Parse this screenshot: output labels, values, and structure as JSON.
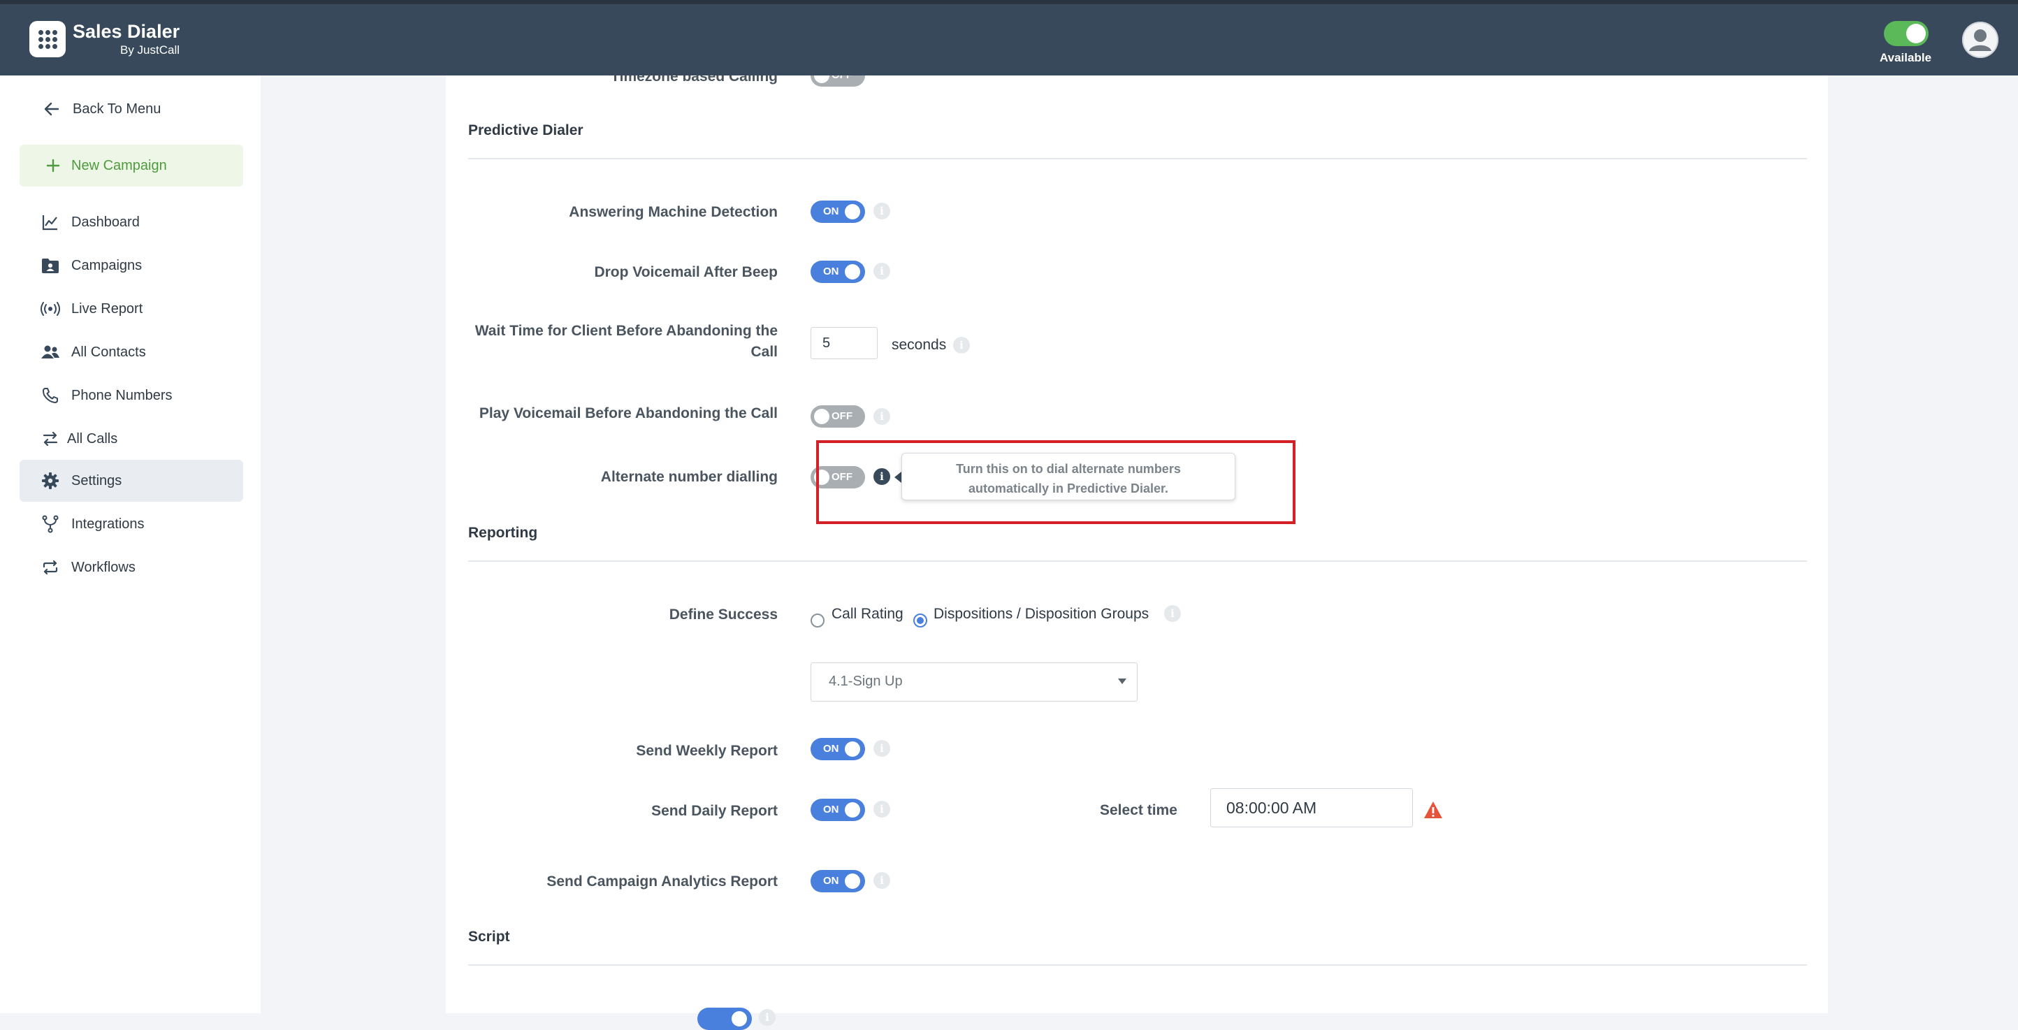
{
  "header": {
    "app_title": "Sales Dialer",
    "app_subtitle": "By JustCall",
    "status_label": "Available"
  },
  "colors": {
    "header_bg": "#37495a",
    "toggle_on": "#4a80dd",
    "toggle_off": "#a9aeb3",
    "available_green": "#5bb95a",
    "highlight_red": "#d42027",
    "new_campaign_green": "#4e9b3d"
  },
  "sidebar": {
    "items": [
      {
        "label": "Back To Menu",
        "icon": "arrow-left-icon"
      },
      {
        "label": "New Campaign",
        "icon": "plus-icon"
      },
      {
        "label": "Dashboard",
        "icon": "chart-line-icon"
      },
      {
        "label": "Campaigns",
        "icon": "folder-user-icon"
      },
      {
        "label": "Live Report",
        "icon": "broadcast-icon"
      },
      {
        "label": "All Contacts",
        "icon": "users-icon"
      },
      {
        "label": "Phone Numbers",
        "icon": "phone-icon"
      },
      {
        "label": "All Calls",
        "icon": "arrows-swap-icon"
      },
      {
        "label": "Settings",
        "icon": "gear-icon",
        "active": true
      },
      {
        "label": "Integrations",
        "icon": "integration-fork-icon"
      },
      {
        "label": "Workflows",
        "icon": "repeat-icon"
      }
    ]
  },
  "main": {
    "partial_top": {
      "label": "Timezone based Calling",
      "state": "OFF"
    },
    "predictive": {
      "title": "Predictive Dialer",
      "amd": {
        "label": "Answering Machine Detection",
        "state": "ON"
      },
      "drop_vm": {
        "label": "Drop Voicemail After Beep",
        "state": "ON"
      },
      "wait_time": {
        "label_line1": "Wait Time for Client Before Abandoning the",
        "label_line2": "Call",
        "value": "5",
        "unit": "seconds"
      },
      "play_vm": {
        "label": "Play Voicemail Before Abandoning the Call",
        "state": "OFF"
      },
      "alternate": {
        "label": "Alternate number dialling",
        "state": "OFF",
        "tooltip_line1": "Turn this on to dial alternate numbers",
        "tooltip_line2": "automatically in Predictive Dialer."
      }
    },
    "reporting": {
      "title": "Reporting",
      "define_success": {
        "label": "Define Success",
        "options": [
          "Call Rating",
          "Dispositions / Disposition Groups"
        ],
        "selected": "Dispositions / Disposition Groups",
        "select_value": "4.1-Sign Up"
      },
      "weekly": {
        "label": "Send Weekly Report",
        "state": "ON"
      },
      "daily": {
        "label": "Send Daily Report",
        "state": "ON",
        "time_label": "Select time",
        "time_value": "08:00:00 AM"
      },
      "analytics": {
        "label": "Send Campaign Analytics Report",
        "state": "ON"
      }
    },
    "script": {
      "title": "Script"
    }
  }
}
